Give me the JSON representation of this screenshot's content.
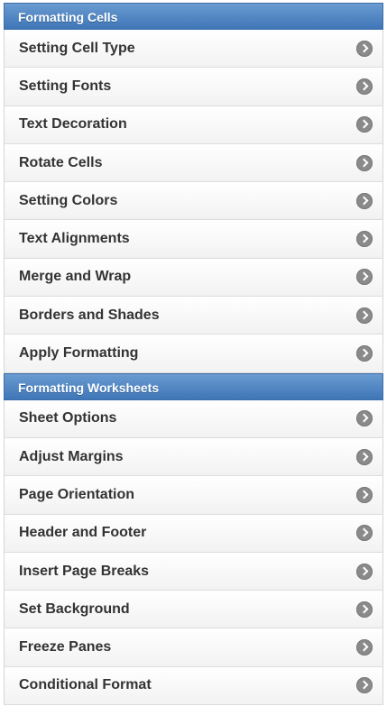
{
  "sections": [
    {
      "title": "Formatting Cells",
      "items": [
        {
          "label": "Setting Cell Type"
        },
        {
          "label": "Setting Fonts"
        },
        {
          "label": "Text Decoration"
        },
        {
          "label": "Rotate Cells"
        },
        {
          "label": "Setting Colors"
        },
        {
          "label": "Text Alignments"
        },
        {
          "label": "Merge and Wrap"
        },
        {
          "label": "Borders and Shades"
        },
        {
          "label": "Apply Formatting"
        }
      ]
    },
    {
      "title": "Formatting Worksheets",
      "items": [
        {
          "label": "Sheet Options"
        },
        {
          "label": "Adjust Margins"
        },
        {
          "label": "Page Orientation"
        },
        {
          "label": "Header and Footer"
        },
        {
          "label": "Insert Page Breaks"
        },
        {
          "label": "Set Background"
        },
        {
          "label": "Freeze Panes"
        },
        {
          "label": "Conditional Format"
        }
      ]
    }
  ],
  "icons": {
    "item_arrow": "chevron-right-circle-icon"
  },
  "colors": {
    "header_bg": "#4a80c0",
    "header_text": "#ffffff",
    "item_text": "#333333",
    "icon_bg": "#8a8a8a"
  }
}
